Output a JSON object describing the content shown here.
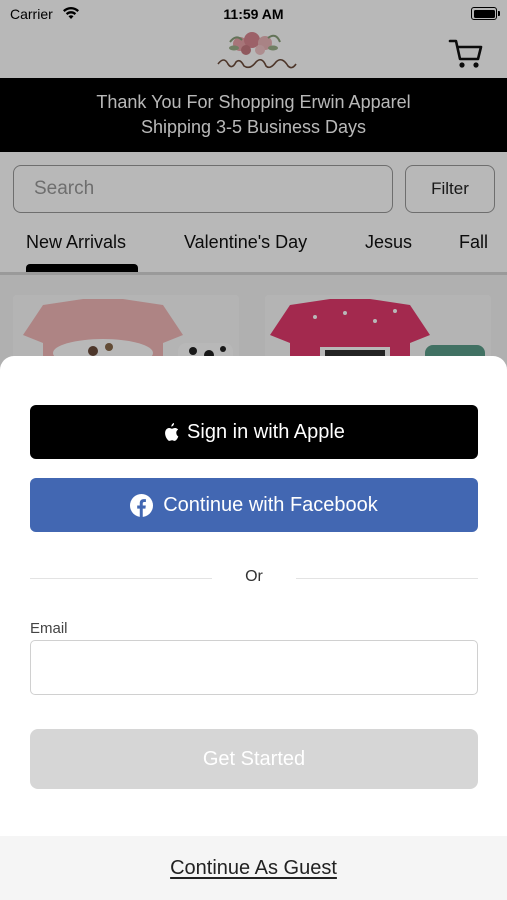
{
  "status_bar": {
    "carrier": "Carrier",
    "time": "11:59 AM",
    "battery_level": 1.0
  },
  "header": {
    "logo_text": "Erwin Apparel",
    "cart_icon": "cart-icon"
  },
  "banner": {
    "line1": "Thank You For Shopping Erwin Apparel",
    "line2": "Shipping 3-5 Business Days"
  },
  "search": {
    "placeholder": "Search",
    "value": ""
  },
  "filter": {
    "label": "Filter"
  },
  "tabs": [
    {
      "label": "New Arrivals",
      "active": true
    },
    {
      "label": "Valentine's Day",
      "active": false
    },
    {
      "label": "Jesus",
      "active": false
    },
    {
      "label": "Fall",
      "active": false
    }
  ],
  "sheet": {
    "apple_label": "Sign in with Apple",
    "facebook_label": "Continue with Facebook",
    "or_label": "Or",
    "email_label": "Email",
    "email_value": "",
    "get_started_label": "Get Started",
    "guest_label": "Continue As Guest"
  },
  "colors": {
    "facebook": "#4267b2",
    "apple": "#000000",
    "disabled_button": "#d6d6d6",
    "banner_bg": "#000000"
  }
}
